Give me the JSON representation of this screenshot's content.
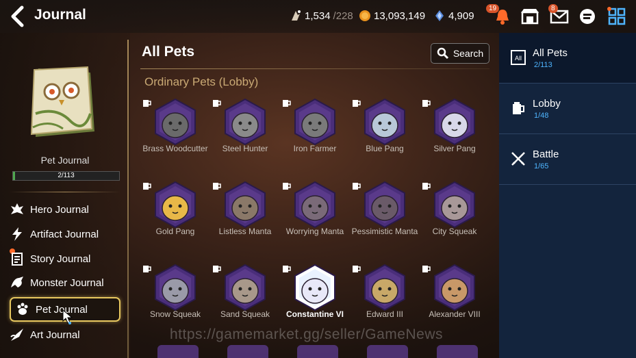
{
  "header": {
    "title": "Journal",
    "resources": [
      {
        "icon": "stamina-icon",
        "value": "1,534",
        "max": "/228"
      },
      {
        "icon": "gold-icon",
        "value": "13,093,149"
      },
      {
        "icon": "skystone-icon",
        "value": "4,909"
      }
    ],
    "notifications_badge": "19",
    "mail_badge": "8"
  },
  "left_panel": {
    "book_name": "Pet Journal",
    "progress_text": "2/113",
    "progress_fraction": 0.018,
    "nav": [
      {
        "label": "Hero Journal",
        "icon": "hero-icon"
      },
      {
        "label": "Artifact Journal",
        "icon": "artifact-icon"
      },
      {
        "label": "Story Journal",
        "icon": "story-icon"
      },
      {
        "label": "Monster Journal",
        "icon": "monster-icon"
      },
      {
        "label": "Pet Journal",
        "icon": "paw-icon"
      },
      {
        "label": "Art Journal",
        "icon": "art-icon"
      }
    ]
  },
  "content": {
    "title": "All Pets",
    "search_label": "Search",
    "section": "Ordinary Pets (Lobby)",
    "pets": [
      {
        "name": "Brass Woodcutter"
      },
      {
        "name": "Steel Hunter"
      },
      {
        "name": "Iron Farmer"
      },
      {
        "name": "Blue Pang"
      },
      {
        "name": "Silver Pang"
      },
      {
        "name": "Gold Pang"
      },
      {
        "name": "Listless Manta"
      },
      {
        "name": "Worrying Manta"
      },
      {
        "name": "Pessimistic Manta"
      },
      {
        "name": "City Squeak"
      },
      {
        "name": "Snow Squeak"
      },
      {
        "name": "Sand Squeak"
      },
      {
        "name": "Constantine VI"
      },
      {
        "name": "Edward III"
      },
      {
        "name": "Alexander VIII"
      }
    ]
  },
  "right_panel": {
    "tabs": [
      {
        "label": "All Pets",
        "count": "2/113"
      },
      {
        "label": "Lobby",
        "count": "1/48"
      },
      {
        "label": "Battle",
        "count": "1/65"
      }
    ]
  },
  "watermark": "https://gamemarket.gg/seller/GameNews"
}
